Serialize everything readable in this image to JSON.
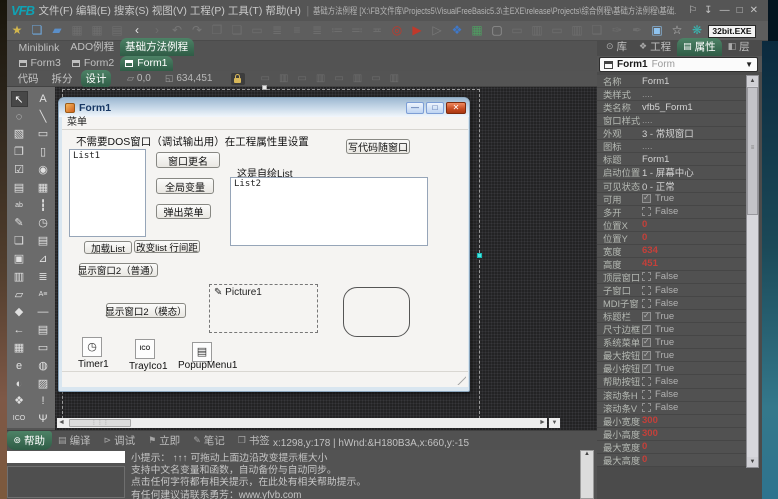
{
  "menu": {
    "logo": "VFB",
    "items": [
      "文件(F)",
      "编辑(E)",
      "搜索(S)",
      "视图(V)",
      "工程(P)",
      "工具(T)",
      "帮助(H)"
    ],
    "title_path": "基础方法例程 [X:\\FB文件库\\Projects5\\VisualFreeBasic5.3\\主EXE\\release\\Projects\\综合例程\\基础方法例程\\基础...",
    "window_buttons": [
      "⚐",
      "↧",
      "—",
      "□",
      "✕"
    ]
  },
  "toolbar": {
    "exe_badge": "32bit.EXE",
    "icons": [
      {
        "n": "favorite-icon",
        "g": "★",
        "c": "#d2b64d"
      },
      {
        "n": "new-file-icon",
        "g": "❏",
        "c": "#6fa8dc"
      },
      {
        "n": "open-folder-icon",
        "g": "▰",
        "c": "#5b8fc9"
      },
      {
        "n": "save-icon",
        "g": "▦",
        "c": "#6e6e6e"
      },
      {
        "n": "save-all-icon",
        "g": "▦",
        "c": "#6e6e6e"
      },
      {
        "n": "export-icon",
        "g": "▤",
        "c": "#6e6e6e"
      },
      {
        "n": "back-icon",
        "g": "‹",
        "c": "#e8e8e8"
      },
      {
        "n": "forward-icon",
        "g": "›",
        "c": "#6e6e6e"
      },
      {
        "n": "undo-icon",
        "g": "↶",
        "c": "#777777"
      },
      {
        "n": "redo-icon",
        "g": "↷",
        "c": "#777777"
      },
      {
        "n": "paste-icon",
        "g": "❐",
        "c": "#6e6e6e"
      },
      {
        "n": "copy-icon",
        "g": "❏",
        "c": "#6e6e6e"
      },
      {
        "n": "delete-icon",
        "g": "▭",
        "c": "#6e6e6e"
      },
      {
        "n": "align-left-icon",
        "g": "≣",
        "c": "#6e6e6e"
      },
      {
        "n": "align-center-icon",
        "g": "≡",
        "c": "#6e6e6e"
      },
      {
        "n": "align-right-icon",
        "g": "≣",
        "c": "#6e6e6e"
      },
      {
        "n": "list-icon",
        "g": "≔",
        "c": "#6e6e6e"
      },
      {
        "n": "list2-icon",
        "g": "≕",
        "c": "#6e6e6e"
      },
      {
        "n": "indent-icon",
        "g": "≖",
        "c": "#6e6e6e"
      },
      {
        "n": "record-icon",
        "g": "◎",
        "c": "#c0392b"
      },
      {
        "n": "run-icon",
        "g": "▶",
        "c": "#c0392b"
      },
      {
        "n": "step-icon",
        "g": "▷",
        "c": "#7a7a7a"
      },
      {
        "n": "layers-icon",
        "g": "❖",
        "c": "#3f78c8"
      },
      {
        "n": "image-icon",
        "g": "▦",
        "c": "#4f9d62"
      },
      {
        "n": "window-icon",
        "g": "▢",
        "c": "#9a9a9a"
      },
      {
        "n": "tool1-icon",
        "g": "▭",
        "c": "#6e6e6e"
      },
      {
        "n": "tool2-icon",
        "g": "▥",
        "c": "#6e6e6e"
      },
      {
        "n": "tool3-icon",
        "g": "▭",
        "c": "#6e6e6e"
      },
      {
        "n": "tool4-icon",
        "g": "▥",
        "c": "#6e6e6e"
      },
      {
        "n": "tool5-icon",
        "g": "❑",
        "c": "#6e6e6e"
      },
      {
        "n": "chat-icon",
        "g": "✑",
        "c": "#6e6e6e"
      },
      {
        "n": "magic-icon",
        "g": "✒",
        "c": "#6e6e6e"
      },
      {
        "n": "form-edit-icon",
        "g": "▣",
        "c": "#8fc3ef"
      },
      {
        "n": "star-box-icon",
        "g": "☆",
        "c": "#c9c9c9"
      },
      {
        "n": "teal-icon",
        "g": "❋",
        "c": "#39b5b0"
      }
    ]
  },
  "project_tabs": {
    "t0": "Miniblink",
    "t1": "ADO例程",
    "t2": "基础方法例程"
  },
  "form_tabs": {
    "t0": "Form3",
    "t1": "Form2",
    "t2": "Form1"
  },
  "design_bar": {
    "code": "代码",
    "split": "拆分",
    "design": "设计",
    "pos": "0,0",
    "size": "634,451"
  },
  "toolbox": {
    "tools": [
      {
        "n": "pointer-tool",
        "g": "↖",
        "sel": 1
      },
      {
        "n": "label-tool",
        "g": "A"
      },
      {
        "n": "shape-tool",
        "g": "◌"
      },
      {
        "n": "line-tool",
        "g": "╲"
      },
      {
        "n": "image-tool",
        "g": "▧"
      },
      {
        "n": "frame-tool",
        "g": "▭"
      },
      {
        "n": "button-tool",
        "g": "❐"
      },
      {
        "n": "panel-tool",
        "g": "▯"
      },
      {
        "n": "checkbox-tool",
        "g": "☑"
      },
      {
        "n": "radio-tool",
        "g": "◉"
      },
      {
        "n": "listbox-tool",
        "g": "▤"
      },
      {
        "n": "listview-tool",
        "g": "▦"
      },
      {
        "n": "textbox-tool",
        "g": "ab",
        "small": 1
      },
      {
        "n": "vscroll-tool",
        "g": "┇"
      },
      {
        "n": "pen-tool",
        "g": "✎"
      },
      {
        "n": "timer-tool",
        "g": "◷"
      },
      {
        "n": "copybox-tool",
        "g": "❏"
      },
      {
        "n": "doc-tool",
        "g": "▤"
      },
      {
        "n": "tv-tool",
        "g": "▣"
      },
      {
        "n": "chart-tool",
        "g": "⊿"
      },
      {
        "n": "keyboard-tool",
        "g": "▥"
      },
      {
        "n": "tree-tool",
        "g": "≣"
      },
      {
        "n": "folder-tool",
        "g": "▱"
      },
      {
        "n": "richtext-tool",
        "g": "A≡",
        "small": 1
      },
      {
        "n": "updown-tool",
        "g": "◆"
      },
      {
        "n": "hline-tool",
        "g": "—"
      },
      {
        "n": "arrow-left-tool",
        "g": "←"
      },
      {
        "n": "datepicker-tool",
        "g": "▤"
      },
      {
        "n": "calendar-tool",
        "g": "▦"
      },
      {
        "n": "combobox-tool",
        "g": "▭"
      },
      {
        "n": "browser-tool",
        "g": "e"
      },
      {
        "n": "globe-tool",
        "g": "◍"
      },
      {
        "n": "planet-tool",
        "g": "◐"
      },
      {
        "n": "picturebox-tool",
        "g": "▨"
      },
      {
        "n": "layers-tool",
        "g": "❖"
      },
      {
        "n": "warning-tool",
        "g": "!"
      },
      {
        "n": "ico-tool",
        "g": "ICO",
        "small": 1
      },
      {
        "n": "anchor-tool",
        "g": "Ψ"
      }
    ]
  },
  "form": {
    "title": "Form1",
    "menu": "菜单",
    "label_dos": "不需要DOS窗口（调试输出用）在工程属性里设置",
    "list1": "List1",
    "btn_rename": "窗口更名",
    "btn_global": "全局变量",
    "btn_popup": "弹出菜单",
    "btn_code": "写代码随窗口",
    "label_selfdraw": "这是自绘List",
    "list2": "List2",
    "btn_load": "加载List",
    "btn_spacing": "改变list 行间距",
    "btn_show_normal": "显示窗口2（普通）",
    "btn_show_modal": "显示窗口2（模态）",
    "picture": "Picture1",
    "timer": "Timer1",
    "tray": "TrayIco1",
    "popup": "PopupMenu1",
    "min_glyph": "—",
    "max_glyph": "□",
    "close_glyph": "✕"
  },
  "panel": {
    "tabs": {
      "t0": "库",
      "t1": "工程",
      "t2": "属性",
      "t3": "层"
    },
    "tab_icons": {
      "t0": "⊙",
      "t1": "❖",
      "t2": "▤",
      "t3": "◧"
    },
    "object_name": "Form1",
    "object_type": "Form",
    "properties": [
      {
        "l": "名称",
        "v": "Form1",
        "t": "text"
      },
      {
        "l": "类样式",
        "v": "....",
        "t": "dim"
      },
      {
        "l": "类名称",
        "v": "vfb5_Form1",
        "t": "text"
      },
      {
        "l": "窗口样式",
        "v": "....",
        "t": "dim"
      },
      {
        "l": "外观",
        "v": "3 - 常规窗口",
        "t": "text"
      },
      {
        "l": "图标",
        "v": "....",
        "t": "dim"
      },
      {
        "l": "标题",
        "v": "Form1",
        "t": "text"
      },
      {
        "l": "启动位置",
        "v": "1 - 屏幕中心",
        "t": "text"
      },
      {
        "l": "可见状态",
        "v": "0 - 正常",
        "t": "text"
      },
      {
        "l": "可用",
        "v": "True",
        "t": "ct"
      },
      {
        "l": "多开",
        "v": "False",
        "t": "cf"
      },
      {
        "l": "位置X",
        "v": "0",
        "t": "red"
      },
      {
        "l": "位置Y",
        "v": "0",
        "t": "red"
      },
      {
        "l": "宽度",
        "v": "634",
        "t": "red"
      },
      {
        "l": "高度",
        "v": "451",
        "t": "red"
      },
      {
        "l": "顶层窗口",
        "v": "False",
        "t": "cf"
      },
      {
        "l": "子窗口",
        "v": "False",
        "t": "cf"
      },
      {
        "l": "MDI子窗",
        "v": "False",
        "t": "cf"
      },
      {
        "l": "标题栏",
        "v": "True",
        "t": "ct"
      },
      {
        "l": "尺寸边框",
        "v": "True",
        "t": "ct"
      },
      {
        "l": "系统菜单",
        "v": "True",
        "t": "ct"
      },
      {
        "l": "最大按钮",
        "v": "True",
        "t": "ct"
      },
      {
        "l": "最小按钮",
        "v": "True",
        "t": "ct"
      },
      {
        "l": "帮助按钮",
        "v": "False",
        "t": "cf"
      },
      {
        "l": "滚动条H",
        "v": "False",
        "t": "cf"
      },
      {
        "l": "滚动条V",
        "v": "False",
        "t": "cf"
      },
      {
        "l": "最小宽度",
        "v": "300",
        "t": "red"
      },
      {
        "l": "最小高度",
        "v": "300",
        "t": "red"
      },
      {
        "l": "最大宽度",
        "v": "0",
        "t": "red"
      },
      {
        "l": "最大高度",
        "v": "0",
        "t": "red"
      }
    ]
  },
  "bottom": {
    "tabs": [
      {
        "label": "帮助",
        "icon": "⊚",
        "active": 1
      },
      {
        "label": "编译",
        "icon": "▤"
      },
      {
        "label": "调试",
        "icon": "⊳"
      },
      {
        "label": "立即",
        "icon": "⚑"
      },
      {
        "label": "笔记",
        "icon": "✎"
      },
      {
        "label": "书签",
        "icon": "❒"
      }
    ],
    "status": "x:1298,y:178 | hWnd:&H180B3A,x:660,y:-15",
    "help_lines": [
      "小提示： ↑↑↑ 可拖动上面边沿改变提示框大小",
      "支持中文名变量和函数，自动备份与自动同步。",
      "点击任何字符都有相关提示，在此处有相关帮助提示。",
      "有任何建议请联系勇芳：www.yfvb.com"
    ]
  }
}
